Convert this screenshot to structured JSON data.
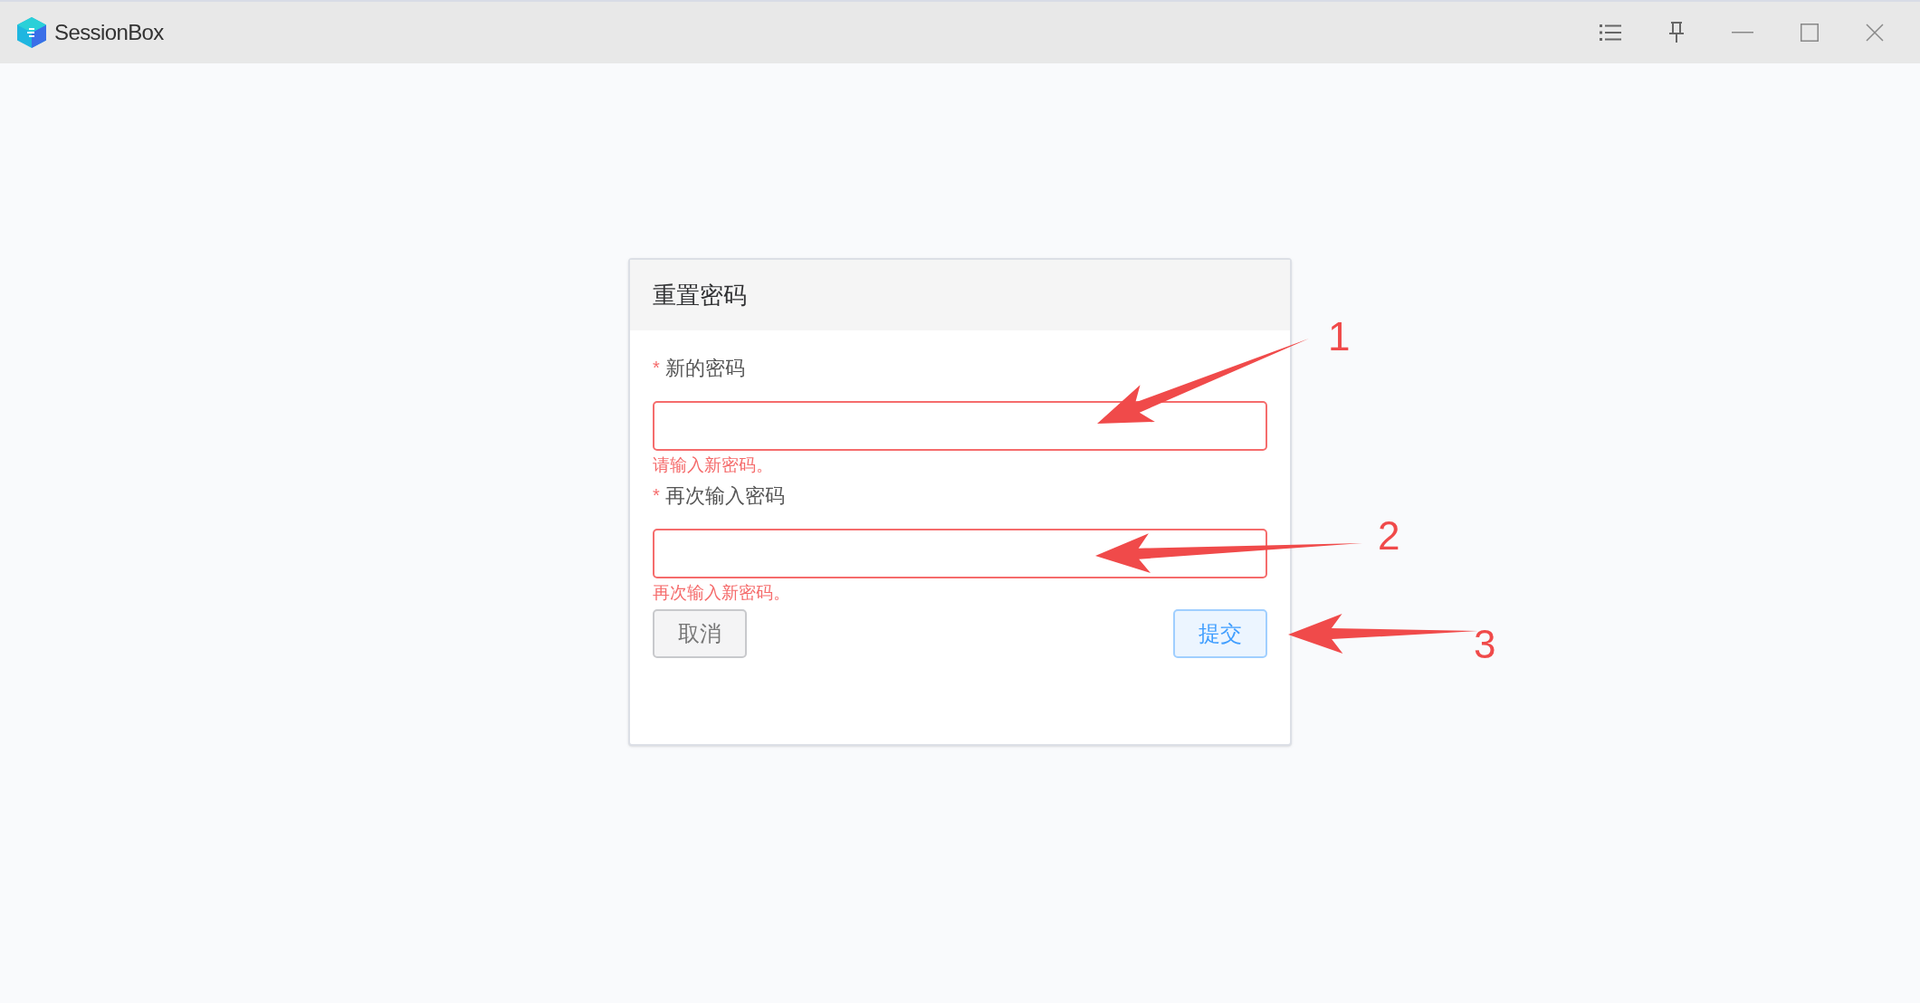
{
  "window": {
    "title": "SessionBox"
  },
  "dialog": {
    "title": "重置密码",
    "fields": [
      {
        "required_mark": "*",
        "label": "新的密码",
        "invalid": true,
        "error": "请输入新密码。"
      },
      {
        "required_mark": "*",
        "label": "再次输入密码",
        "invalid": true,
        "error": "再次输入新密码。"
      }
    ],
    "buttons": [
      {
        "label": "取消",
        "kind": "secondary"
      },
      {
        "label": "提交",
        "kind": "primary"
      }
    ]
  },
  "annotations": [
    {
      "label": "1"
    },
    {
      "label": "2"
    },
    {
      "label": "3"
    }
  ]
}
